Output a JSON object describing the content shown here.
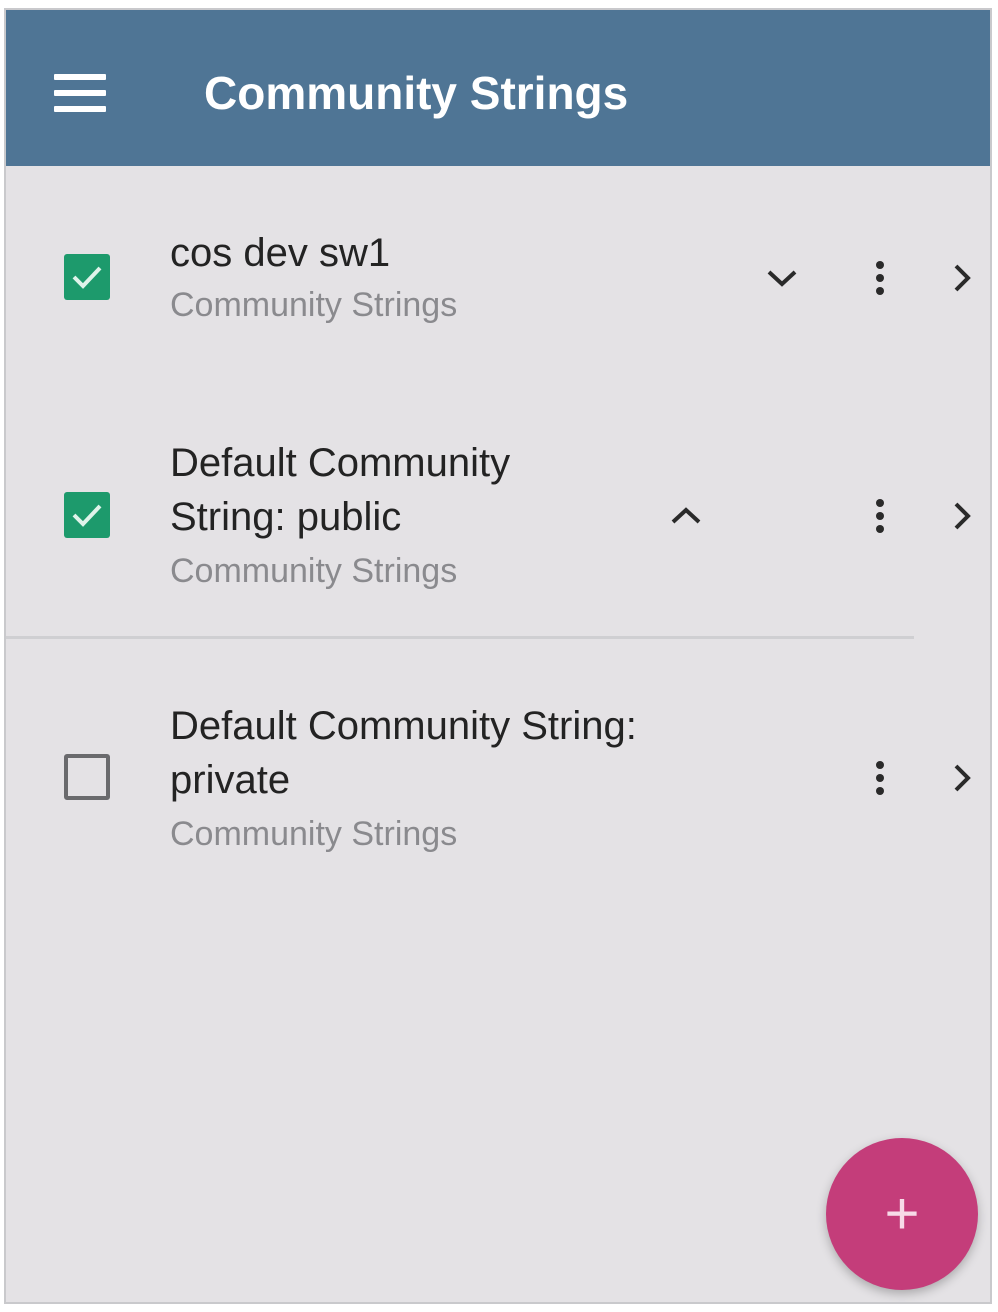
{
  "app_bar": {
    "title": "Community Strings",
    "menu_icon": "hamburger-menu-icon",
    "background": "#4f7595"
  },
  "items": [
    {
      "checked": true,
      "title_lines": [
        "cos dev sw1"
      ],
      "subtitle": "Community Strings",
      "expand_icon": "chevron-down-icon"
    },
    {
      "checked": true,
      "title_lines": [
        "Default Community",
        "String: public"
      ],
      "subtitle": "Community Strings",
      "expand_icon": "chevron-up-icon"
    },
    {
      "checked": false,
      "title_lines": [
        "Default Community String:",
        "private"
      ],
      "subtitle": "Community Strings",
      "expand_icon": ""
    }
  ],
  "colors": {
    "checkbox_checked": "#1d9a6c",
    "fab": "#c43d7a"
  },
  "fab": {
    "label": "+",
    "icon": "plus-icon"
  }
}
